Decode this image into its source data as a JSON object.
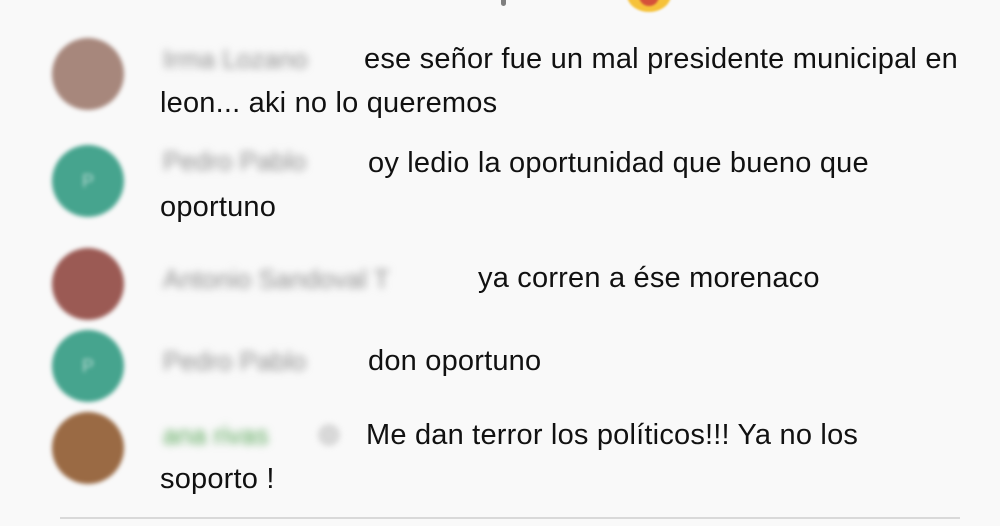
{
  "colors": {
    "background": "#f9f9f9",
    "text": "#111111",
    "author_blur": "#8f8f8f",
    "author_highlight": "#5aa85a"
  },
  "messages": [
    {
      "author": "Irma Lozano",
      "text": "ese señor fue un mal presidente municipal en leon... aki no lo queremos",
      "avatar_color": "#a7877c",
      "avatar_icon": "photo-avatar"
    },
    {
      "author": "Pedro Pablo",
      "text": "oy ledio la oportunidad que bueno que oportuno",
      "avatar_color": "#46a48e",
      "avatar_icon": "letter-avatar",
      "avatar_letter": "P"
    },
    {
      "author": "Antonio Sandoval T",
      "text": "ya corren a ése morenaco",
      "avatar_color": "#9b5a54",
      "avatar_icon": "photo-avatar"
    },
    {
      "author": "Pedro Pablo",
      "text": "don oportuno",
      "avatar_color": "#46a48e",
      "avatar_icon": "letter-avatar",
      "avatar_letter": "P"
    },
    {
      "author": "ana rivas",
      "text": "Me dan terror los políticos!!! Ya no los soporto !",
      "avatar_color": "#9a6a44",
      "avatar_icon": "photo-avatar",
      "author_badge": "verified-badge-icon"
    }
  ]
}
